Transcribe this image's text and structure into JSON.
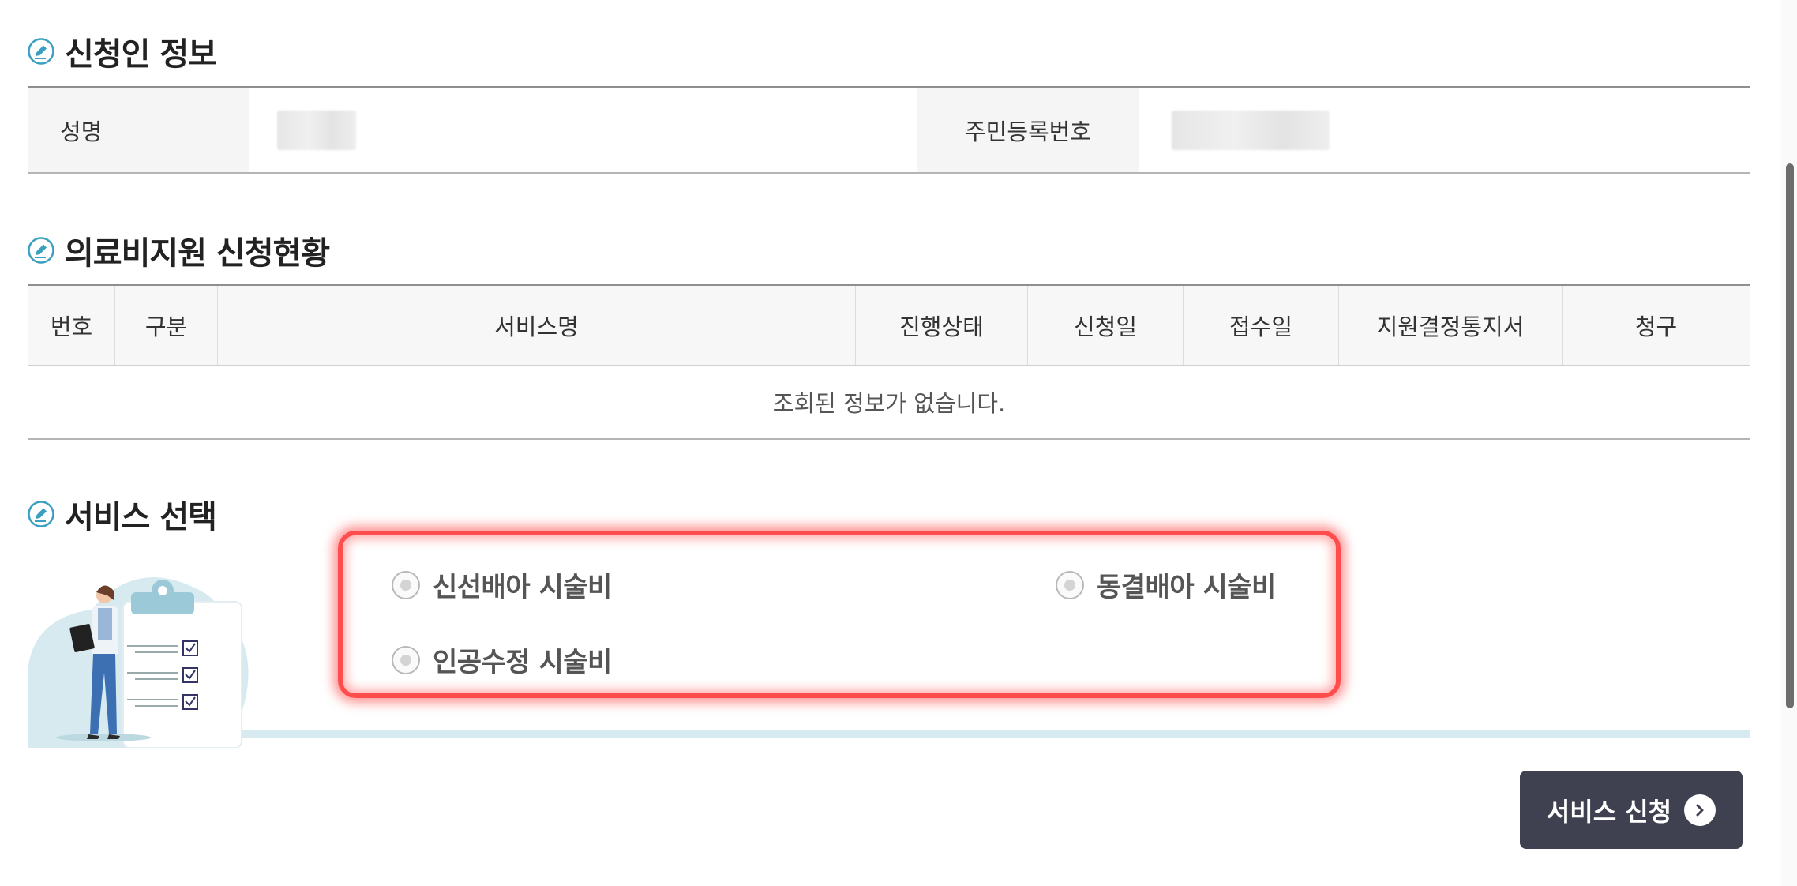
{
  "sections": {
    "applicant": {
      "title": "신청인 정보"
    },
    "status": {
      "title": "의료비지원 신청현황"
    },
    "service": {
      "title": "서비스 선택"
    }
  },
  "applicant": {
    "name_label": "성명",
    "rrn_label": "주민등록번호"
  },
  "status_table": {
    "columns": [
      "번호",
      "구분",
      "서비스명",
      "진행상태",
      "신청일",
      "접수일",
      "지원결정통지서",
      "청구"
    ],
    "empty_message": "조회된 정보가 없습니다."
  },
  "service_options": [
    {
      "label": "신선배아 시술비",
      "selected": false
    },
    {
      "label": "동결배아 시술비",
      "selected": false
    },
    {
      "label": "인공수정 시술비",
      "selected": false
    }
  ],
  "apply_button": {
    "label": "서비스 신청",
    "icon": "chevron-right-icon"
  },
  "colors": {
    "accent_icon": "#3a9fc0",
    "button_bg": "#3f4150",
    "highlight": "#ff4d4d",
    "illustration_bg": "#d6eaf0"
  }
}
